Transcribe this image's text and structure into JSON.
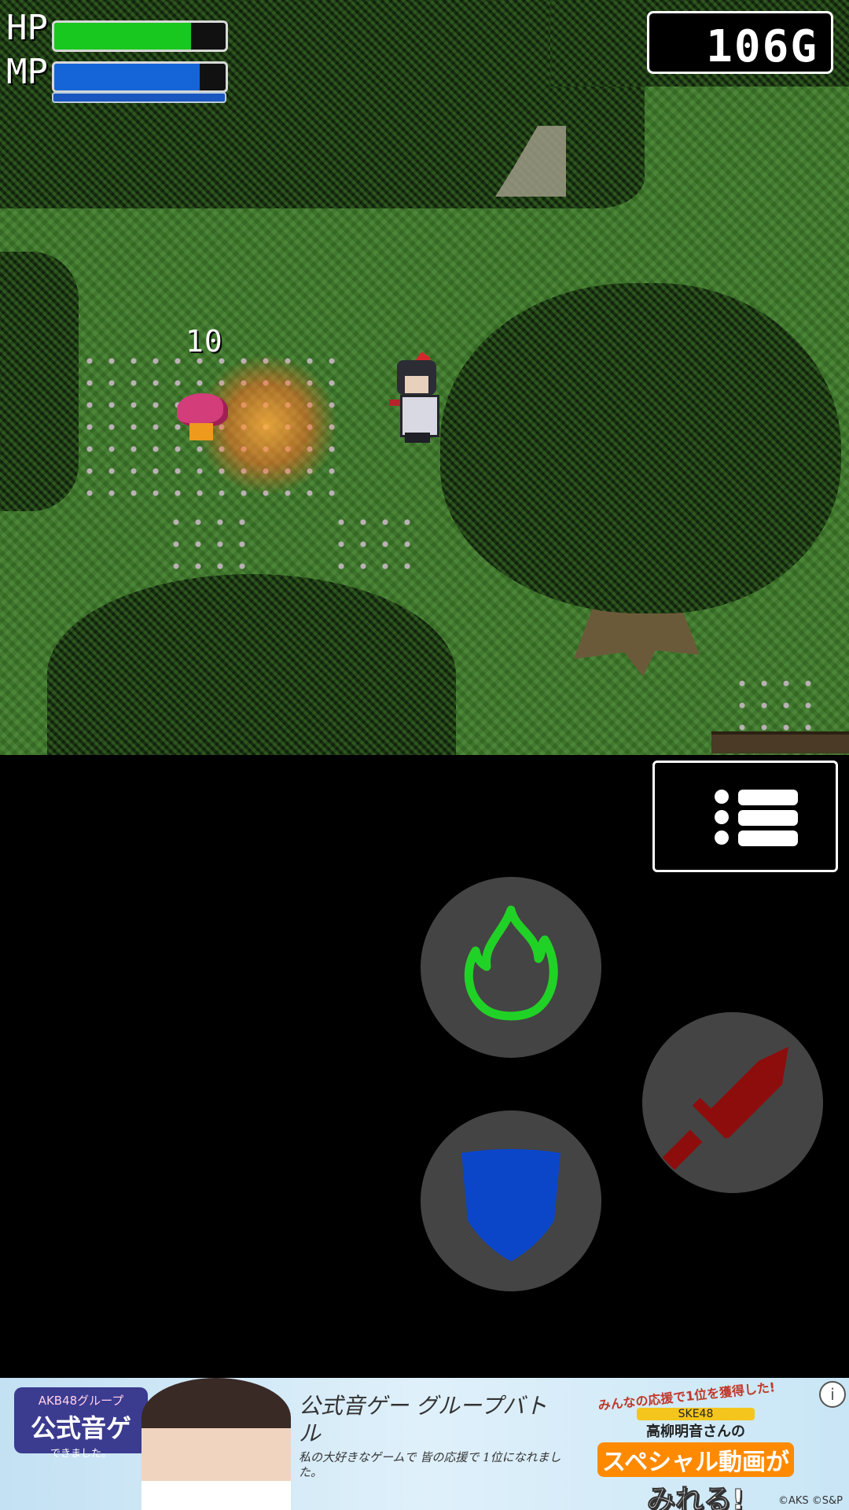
{
  "hud": {
    "hp_label": "HP",
    "mp_label": "MP",
    "hp_fraction": 0.8,
    "mp_fraction": 0.85,
    "gold": "106G"
  },
  "game": {
    "damage_number": "10"
  },
  "controls": {
    "menu_icon": "list-icon",
    "fire_icon": "flame-icon",
    "shield_icon": "shield-icon",
    "sword_icon": "sword-icon",
    "colors": {
      "flame": "#21d226",
      "shield": "#0b46c9",
      "sword": "#8d0d0d",
      "button_bg": "#444444"
    }
  },
  "ad": {
    "logo_small": "AKB48グループ",
    "logo_main": "公式音ゲ",
    "logo_sub": "できました。",
    "script_line1": "公式音ゲー グループバトル",
    "script_line2": "私の大好きなゲームで 皆の応援で 1位になれました。",
    "top_note": "みんなの応援で1位を獲得した!",
    "group": "SKE48",
    "member": "高柳明音さんの",
    "headline": "スペシャル動画が",
    "cta": "みれる!",
    "copyright": "©AKS ©S&P",
    "info_icon": "info-icon"
  }
}
